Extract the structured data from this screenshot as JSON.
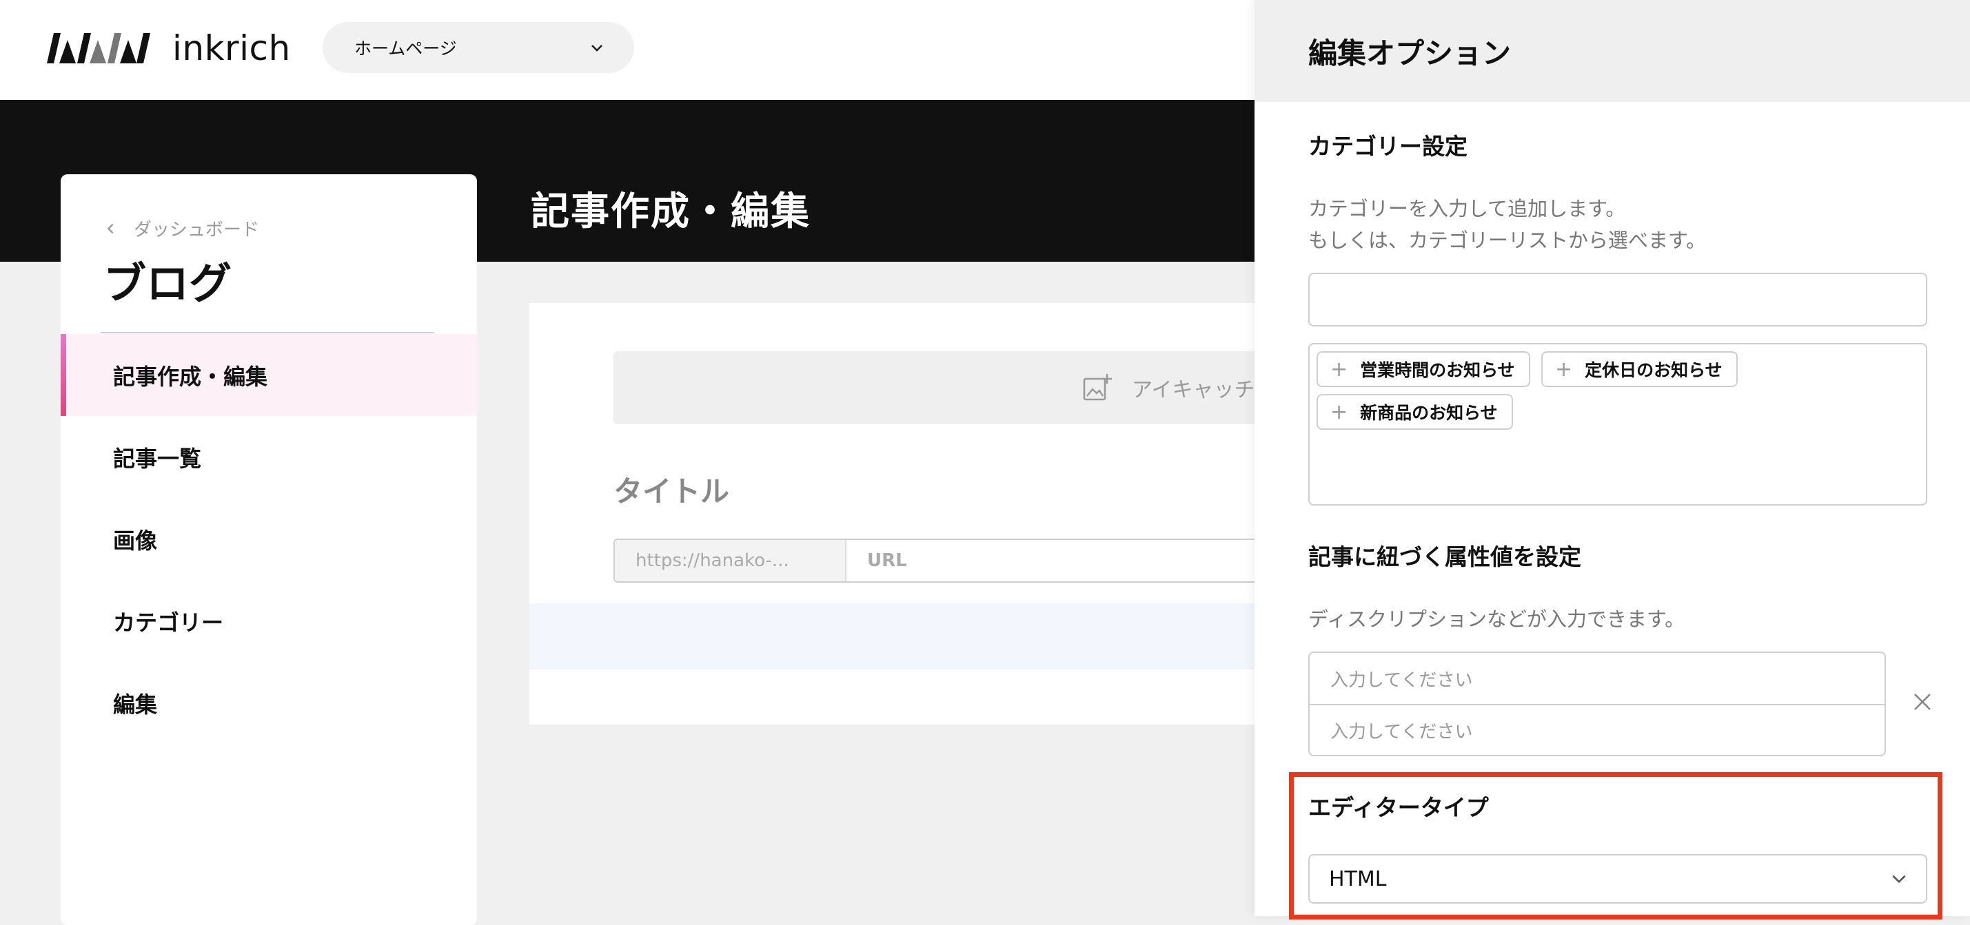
{
  "header": {
    "logo_text": "inkrich",
    "site_select": {
      "value": "ホームページ"
    }
  },
  "hero": {
    "page_title": "記事作成・編集"
  },
  "sidebar": {
    "breadcrumb": "ダッシュボード",
    "title": "ブログ",
    "items": [
      {
        "label": "記事作成・編集",
        "active": true
      },
      {
        "label": "記事一覧"
      },
      {
        "label": "画像"
      },
      {
        "label": "カテゴリー"
      },
      {
        "label": "編集"
      }
    ]
  },
  "editor": {
    "eyecatch_label": "アイキャッチ",
    "title_placeholder": "タイトル",
    "url_prefix": "https://hanako-...",
    "url_placeholder": "URL"
  },
  "drawer": {
    "title": "編集オプション",
    "category": {
      "title": "カテゴリー設定",
      "hint_line1": "カテゴリーを入力して追加します。",
      "hint_line2": "もしくは、カテゴリーリストから選べます。",
      "input_value": "",
      "chips": [
        "営業時間のお知らせ",
        "定休日のお知らせ",
        "新商品のお知らせ"
      ]
    },
    "attributes": {
      "title": "記事に紐づく属性値を設定",
      "hint": "ディスクリプションなどが入力できます。",
      "placeholder_1": "入力してください",
      "placeholder_2": "入力してください"
    },
    "editor_type": {
      "title": "エディタータイプ",
      "value": "HTML"
    }
  },
  "colors": {
    "highlight": "#e8391f",
    "active_nav_bg": "#fdf0f7",
    "hero_bg": "#111111"
  }
}
